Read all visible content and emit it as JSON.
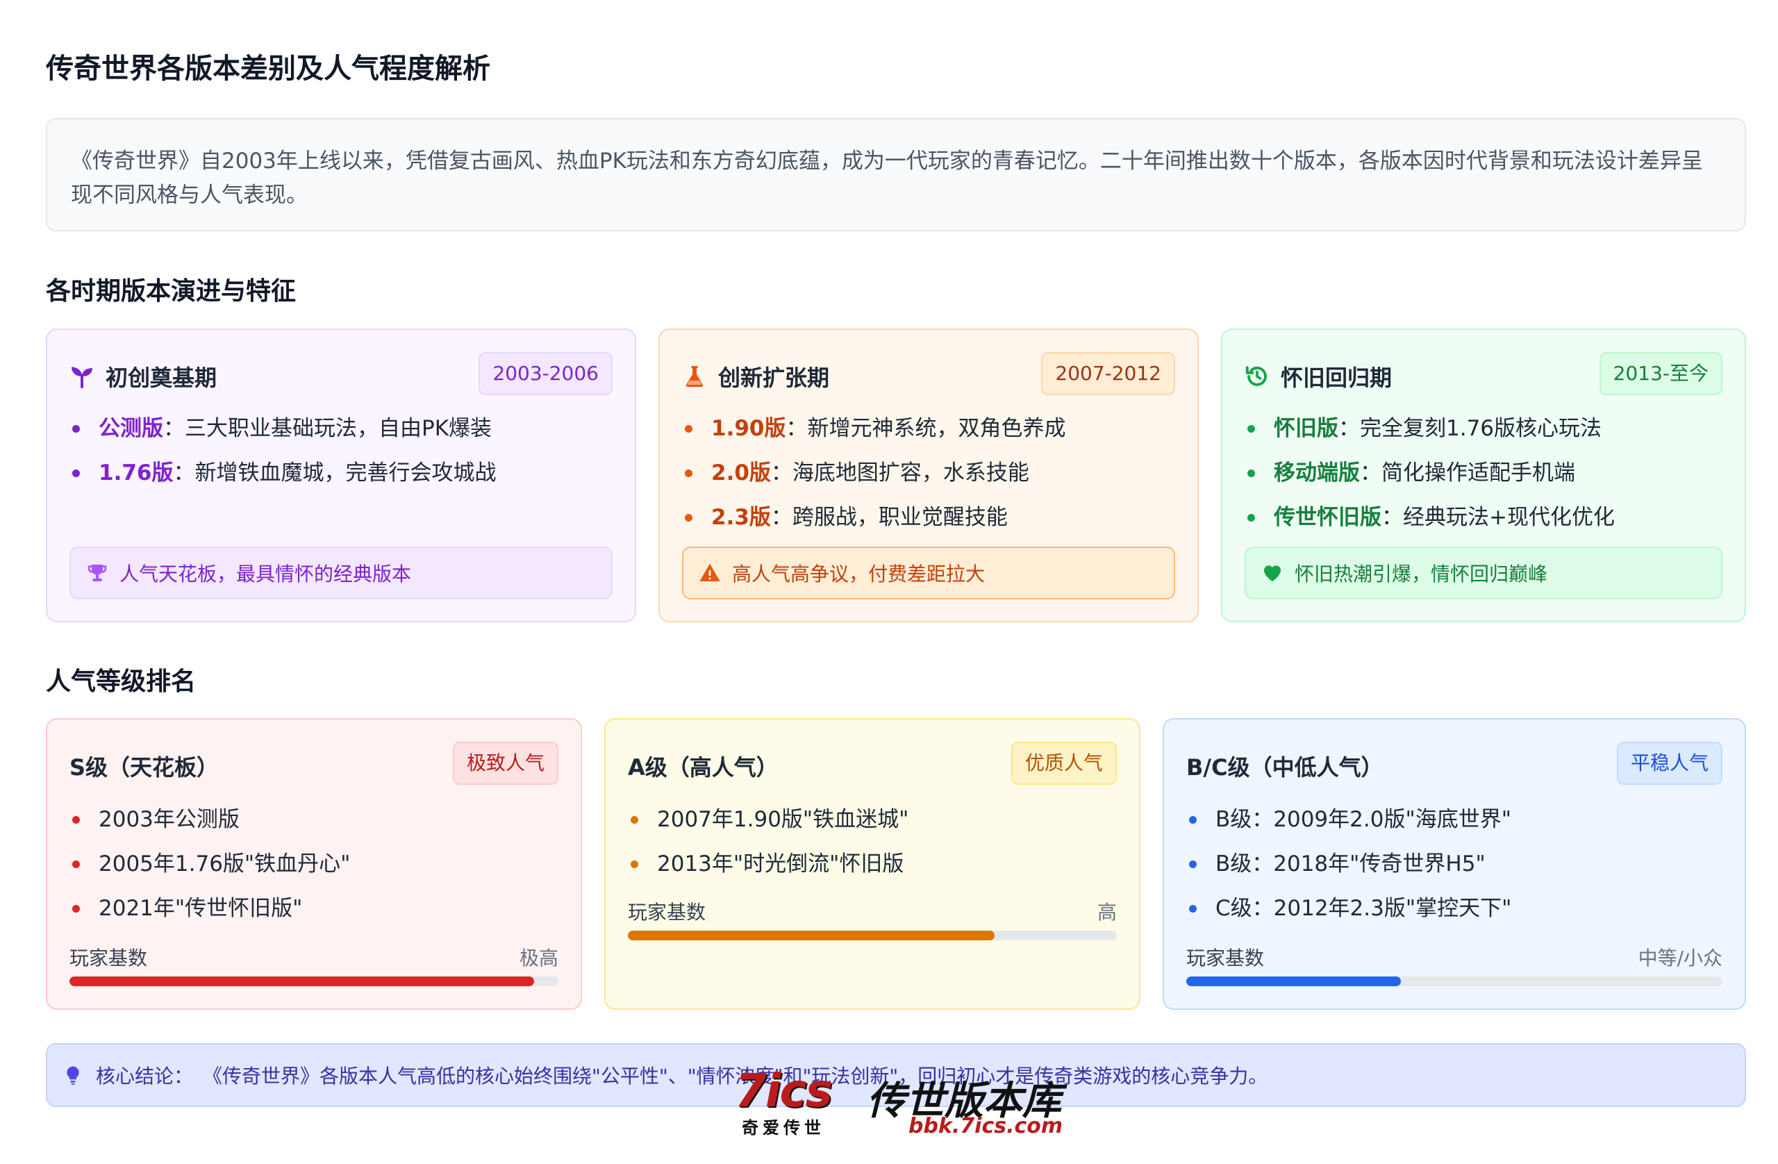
{
  "page": {
    "title": "传奇世界各版本差别及人气程度解析",
    "intro": "《传奇世界》自2003年上线以来，凭借复古画风、热血PK玩法和东方奇幻底蕴，成为一代玩家的青春记忆。二十年间推出数十个版本，各版本因时代背景和玩法设计差异呈现不同风格与人气表现。"
  },
  "periods": {
    "section_title": "各时期版本演进与特征",
    "items": [
      {
        "title": "初创奠基期",
        "badge": "2003-2006",
        "icon": "seedling-icon",
        "accent": "#7e22ce",
        "points": [
          {
            "version": "公测版",
            "desc": "：三大职业基础玩法，自由PK爆装"
          },
          {
            "version": "1.76版",
            "desc": "：新增铁血魔城，完善行会攻城战"
          }
        ],
        "note_icon": "trophy-icon",
        "note": "人气天花板，最具情怀的经典版本"
      },
      {
        "title": "创新扩张期",
        "badge": "2007-2012",
        "icon": "flask-icon",
        "accent": "#c2410c",
        "points": [
          {
            "version": "1.90版",
            "desc": "：新增元神系统，双角色养成"
          },
          {
            "version": "2.0版",
            "desc": "：海底地图扩容，水系技能"
          },
          {
            "version": "2.3版",
            "desc": "：跨服战，职业觉醒技能"
          }
        ],
        "note_icon": "warning-icon",
        "note": "高人气高争议，付费差距拉大"
      },
      {
        "title": "怀旧回归期",
        "badge": "2013-至今",
        "icon": "history-icon",
        "accent": "#15803d",
        "points": [
          {
            "version": "怀旧版",
            "desc": "：完全复刻1.76版核心玩法"
          },
          {
            "version": "移动端版",
            "desc": "：简化操作适配手机端"
          },
          {
            "version": "传世怀旧版",
            "desc": "：经典玩法+现代化优化"
          }
        ],
        "note_icon": "heart-icon",
        "note": "怀旧热潮引爆，情怀回归巅峰"
      }
    ]
  },
  "ranking": {
    "section_title": "人气等级排名",
    "meter_label": "玩家基数",
    "items": [
      {
        "title": "S级（天花板）",
        "badge": "极致人气",
        "entries": [
          "2003年公测版",
          "2005年1.76版\"铁血丹心\"",
          "2021年\"传世怀旧版\""
        ],
        "level": "极高",
        "fill_percent": 95
      },
      {
        "title": "A级（高人气）",
        "badge": "优质人气",
        "entries": [
          "2007年1.90版\"铁血迷城\"",
          "2013年\"时光倒流\"怀旧版"
        ],
        "level": "高",
        "fill_percent": 75
      },
      {
        "title": "B/C级（中低人气）",
        "badge": "平稳人气",
        "entries": [
          "B级：2009年2.0版\"海底世界\"",
          "B级：2018年\"传奇世界H5\"",
          "C级：2012年2.3版\"掌控天下\""
        ],
        "level": "中等/小众",
        "fill_percent": 40
      }
    ]
  },
  "conclusion": {
    "label": "核心结论：",
    "icon": "lightbulb-icon",
    "text": "《传奇世界》各版本人气高低的核心始终围绕\"公平性\"、\"情怀浓度\"和\"玩法创新\"，回归初心才是传奇类游戏的核心竞争力。"
  },
  "watermark": {
    "big": "7ics",
    "brand": "传世版本库",
    "sub": "奇爱传世",
    "url": "bbk.7ics.com"
  }
}
